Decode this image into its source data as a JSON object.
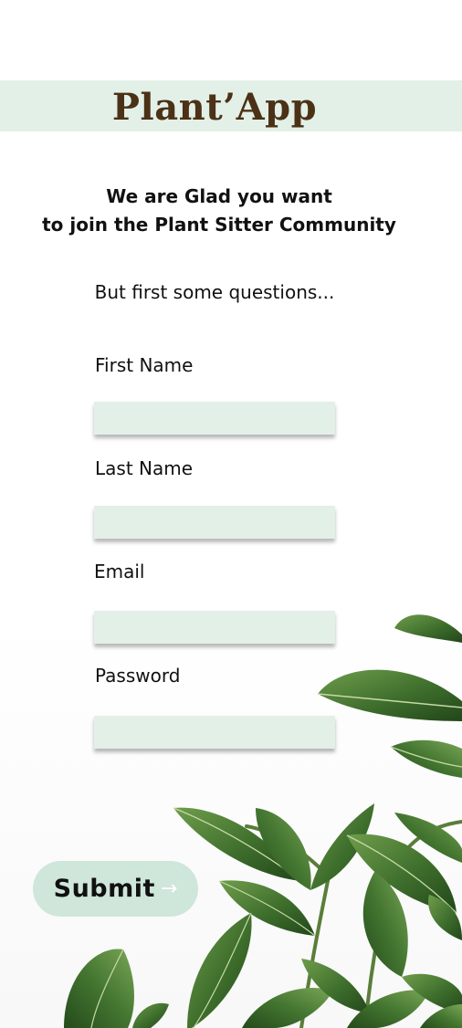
{
  "brand": {
    "title": "Plant’App"
  },
  "welcome": {
    "line1": "We are Glad you want",
    "line2": "to join the Plant Sitter Community"
  },
  "intro": {
    "text": "But first some questions..."
  },
  "form": {
    "first_name": {
      "label": "First Name",
      "value": ""
    },
    "last_name": {
      "label": "Last Name",
      "value": ""
    },
    "email": {
      "label": "Email",
      "value": ""
    },
    "password": {
      "label": "Password",
      "value": ""
    }
  },
  "submit": {
    "label": "Submit",
    "arrow": "→"
  },
  "decoration": {
    "image": "ficus-plant-leaves"
  },
  "colors": {
    "band": "#e3f0e8",
    "brand_text": "#4b3116",
    "input_bg": "#e3f0e8",
    "button_bg": "#cfe6da",
    "leaf_dark": "#2f5a22",
    "leaf_light": "#6e9a4a"
  }
}
